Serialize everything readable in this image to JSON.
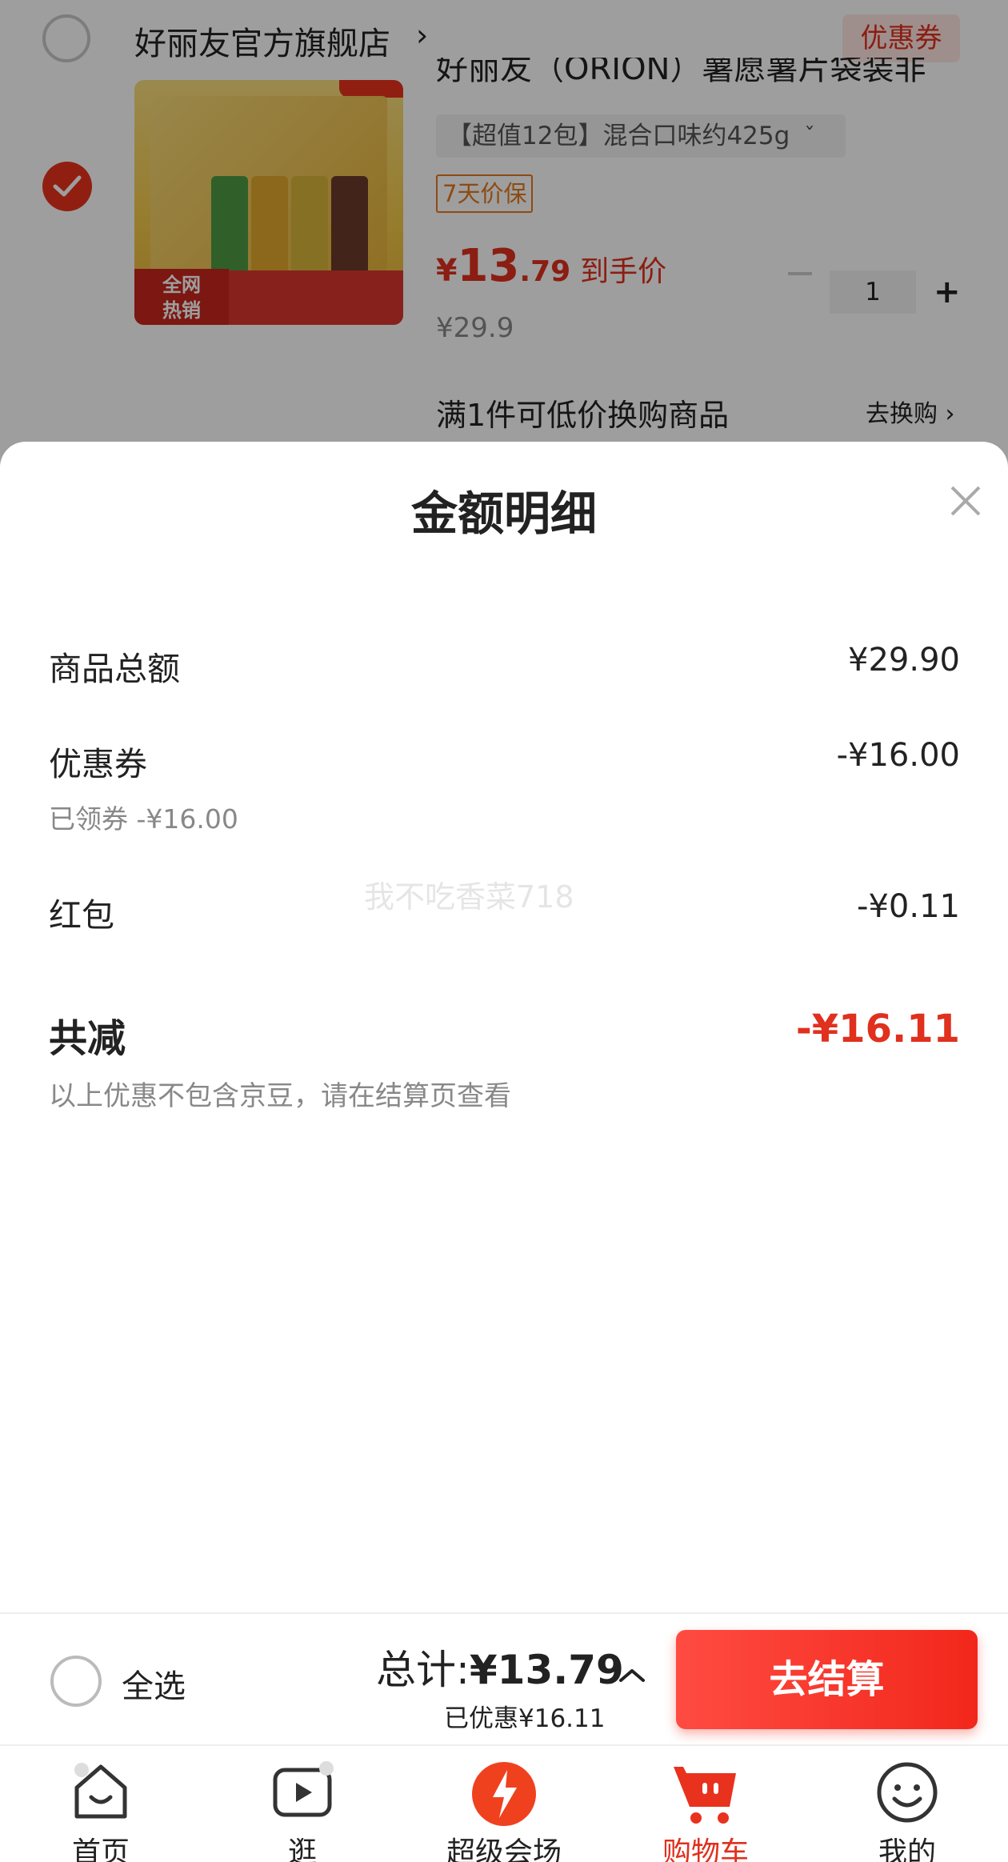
{
  "store": {
    "name": "好丽友官方旗舰店",
    "arrow": "›",
    "coupon_label": "优惠券"
  },
  "product": {
    "title": "好丽友（ORION）薯愿薯片袋装非",
    "spec": "【超值12包】混合口味约425g",
    "spec_caret": "ˇ",
    "guarantee": "7天价保",
    "price_yen": "¥",
    "price_int": "13",
    "price_dec": ".79",
    "price_label": "到手价",
    "original_price": "¥29.9",
    "quantity": "1",
    "swap_text": "满1件可低价换购商品",
    "swap_link": "去换购 ›",
    "image_badge": "全网\n热销"
  },
  "sheet": {
    "title": "金额明细",
    "watermark": "我不吃香菜718",
    "lines": [
      {
        "label": "商品总额",
        "value": "¥29.90"
      },
      {
        "label": "优惠券",
        "value": "-¥16.00",
        "note": "已领券 -¥16.00"
      },
      {
        "label": "红包",
        "value": "-¥0.11"
      }
    ],
    "total_label": "共减",
    "total_value": "-¥16.11",
    "total_note": "以上优惠不包含京豆，请在结算页查看"
  },
  "checkout": {
    "select_all": "全选",
    "total_prefix": "总计:",
    "total_amount": "¥13.79",
    "saved": "已优惠¥16.11",
    "button": "去结算"
  },
  "tabs": [
    {
      "label": "首页",
      "icon": "home-icon"
    },
    {
      "label": "逛",
      "icon": "play-icon"
    },
    {
      "label": "超级会场",
      "icon": "super-venue-icon"
    },
    {
      "label": "购物车",
      "icon": "cart-icon",
      "active": true
    },
    {
      "label": "我的",
      "icon": "profile-icon"
    }
  ],
  "colors": {
    "accent": "#e0301e",
    "button": "#f2271b",
    "muted": "#888888"
  }
}
